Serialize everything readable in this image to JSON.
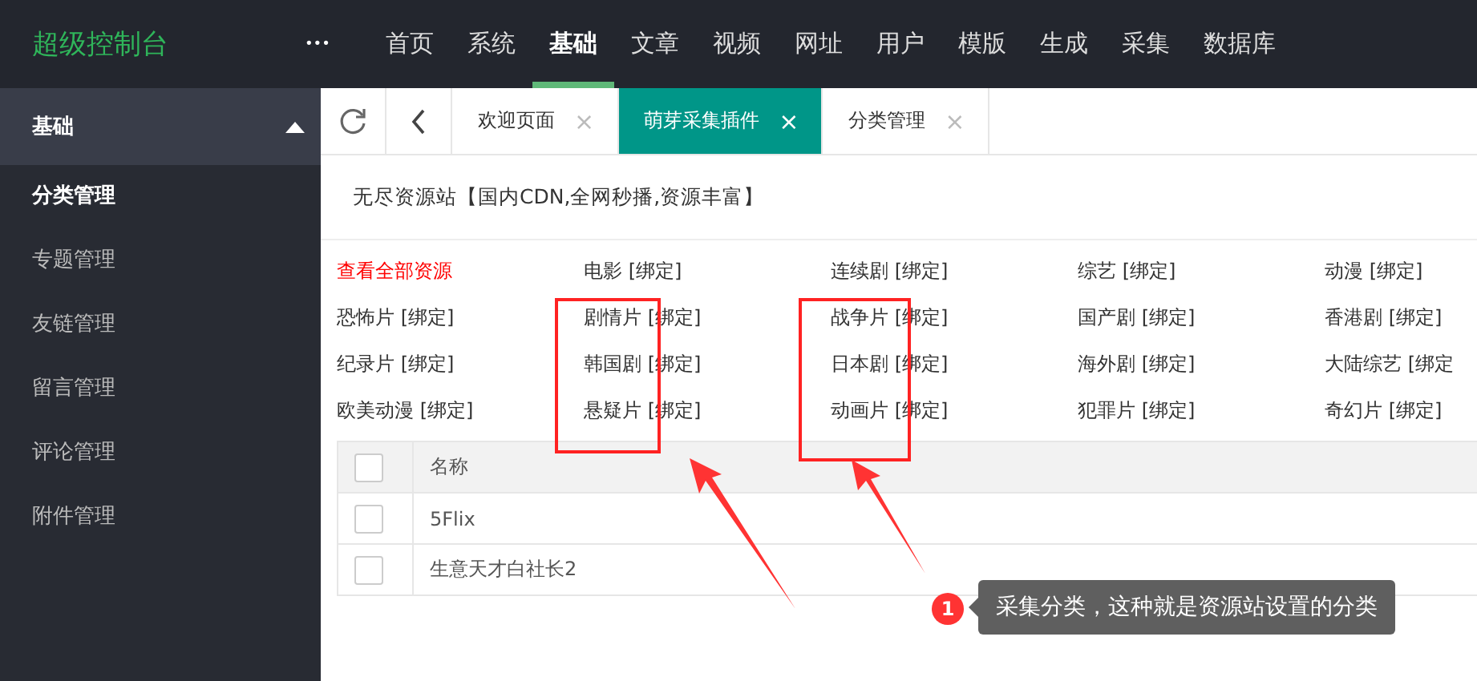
{
  "topbar": {
    "logo": "超级控制台",
    "more": "•••",
    "nav": [
      {
        "label": "首页",
        "selected": false
      },
      {
        "label": "系统",
        "selected": false
      },
      {
        "label": "基础",
        "selected": true
      },
      {
        "label": "文章",
        "selected": false
      },
      {
        "label": "视频",
        "selected": false
      },
      {
        "label": "网址",
        "selected": false
      },
      {
        "label": "用户",
        "selected": false
      },
      {
        "label": "模版",
        "selected": false
      },
      {
        "label": "生成",
        "selected": false
      },
      {
        "label": "采集",
        "selected": false
      },
      {
        "label": "数据库",
        "selected": false
      }
    ]
  },
  "sidebar": {
    "title": "基础",
    "expanded": true,
    "items": [
      {
        "label": "分类管理",
        "selected": true
      },
      {
        "label": "专题管理",
        "selected": false
      },
      {
        "label": "友链管理",
        "selected": false
      },
      {
        "label": "留言管理",
        "selected": false
      },
      {
        "label": "评论管理",
        "selected": false
      },
      {
        "label": "附件管理",
        "selected": false
      }
    ]
  },
  "tabs": [
    {
      "label": "欢迎页面",
      "close": "×",
      "selected": false
    },
    {
      "label": "萌芽采集插件",
      "close": "×",
      "selected": true
    },
    {
      "label": "分类管理",
      "close": "×",
      "selected": false
    }
  ],
  "source_title": "无尽资源站【国内CDN,全网秒播,资源丰富】",
  "categories": [
    {
      "label": "查看全部资源",
      "kind": "all"
    },
    {
      "label": "电影 [绑定]",
      "kind": "bind"
    },
    {
      "label": "连续剧 [绑定]",
      "kind": "bind"
    },
    {
      "label": "综艺 [绑定]",
      "kind": "bind"
    },
    {
      "label": "动漫 [绑定]",
      "kind": "bind"
    },
    {
      "label": "恐怖片 [绑定]",
      "kind": "bind"
    },
    {
      "label": "剧情片 [绑定]",
      "kind": "bind"
    },
    {
      "label": "战争片 [绑定]",
      "kind": "bind"
    },
    {
      "label": "国产剧 [绑定]",
      "kind": "bind"
    },
    {
      "label": "香港剧 [绑定]",
      "kind": "bind"
    },
    {
      "label": "纪录片 [绑定]",
      "kind": "bind"
    },
    {
      "label": "韩国剧 [绑定]",
      "kind": "bind"
    },
    {
      "label": "日本剧 [绑定]",
      "kind": "bind"
    },
    {
      "label": "海外剧 [绑定]",
      "kind": "bind"
    },
    {
      "label": "大陆综艺 [绑定",
      "kind": "bind"
    },
    {
      "label": "欧美动漫 [绑定]",
      "kind": "bind"
    },
    {
      "label": "悬疑片 [绑定]",
      "kind": "bind"
    },
    {
      "label": "动画片 [绑定]",
      "kind": "bind"
    },
    {
      "label": "犯罪片 [绑定]",
      "kind": "bind"
    },
    {
      "label": "奇幻片 [绑定]",
      "kind": "bind"
    }
  ],
  "table": {
    "select_all_checked": false,
    "columns": [
      "名称"
    ],
    "rows": [
      {
        "name": "5Flix",
        "checked": false
      },
      {
        "name": "生意天才白社长2",
        "checked": false
      }
    ]
  },
  "callout": {
    "number": "1",
    "text": "采集分类，这种就是资源站设置的分类"
  }
}
